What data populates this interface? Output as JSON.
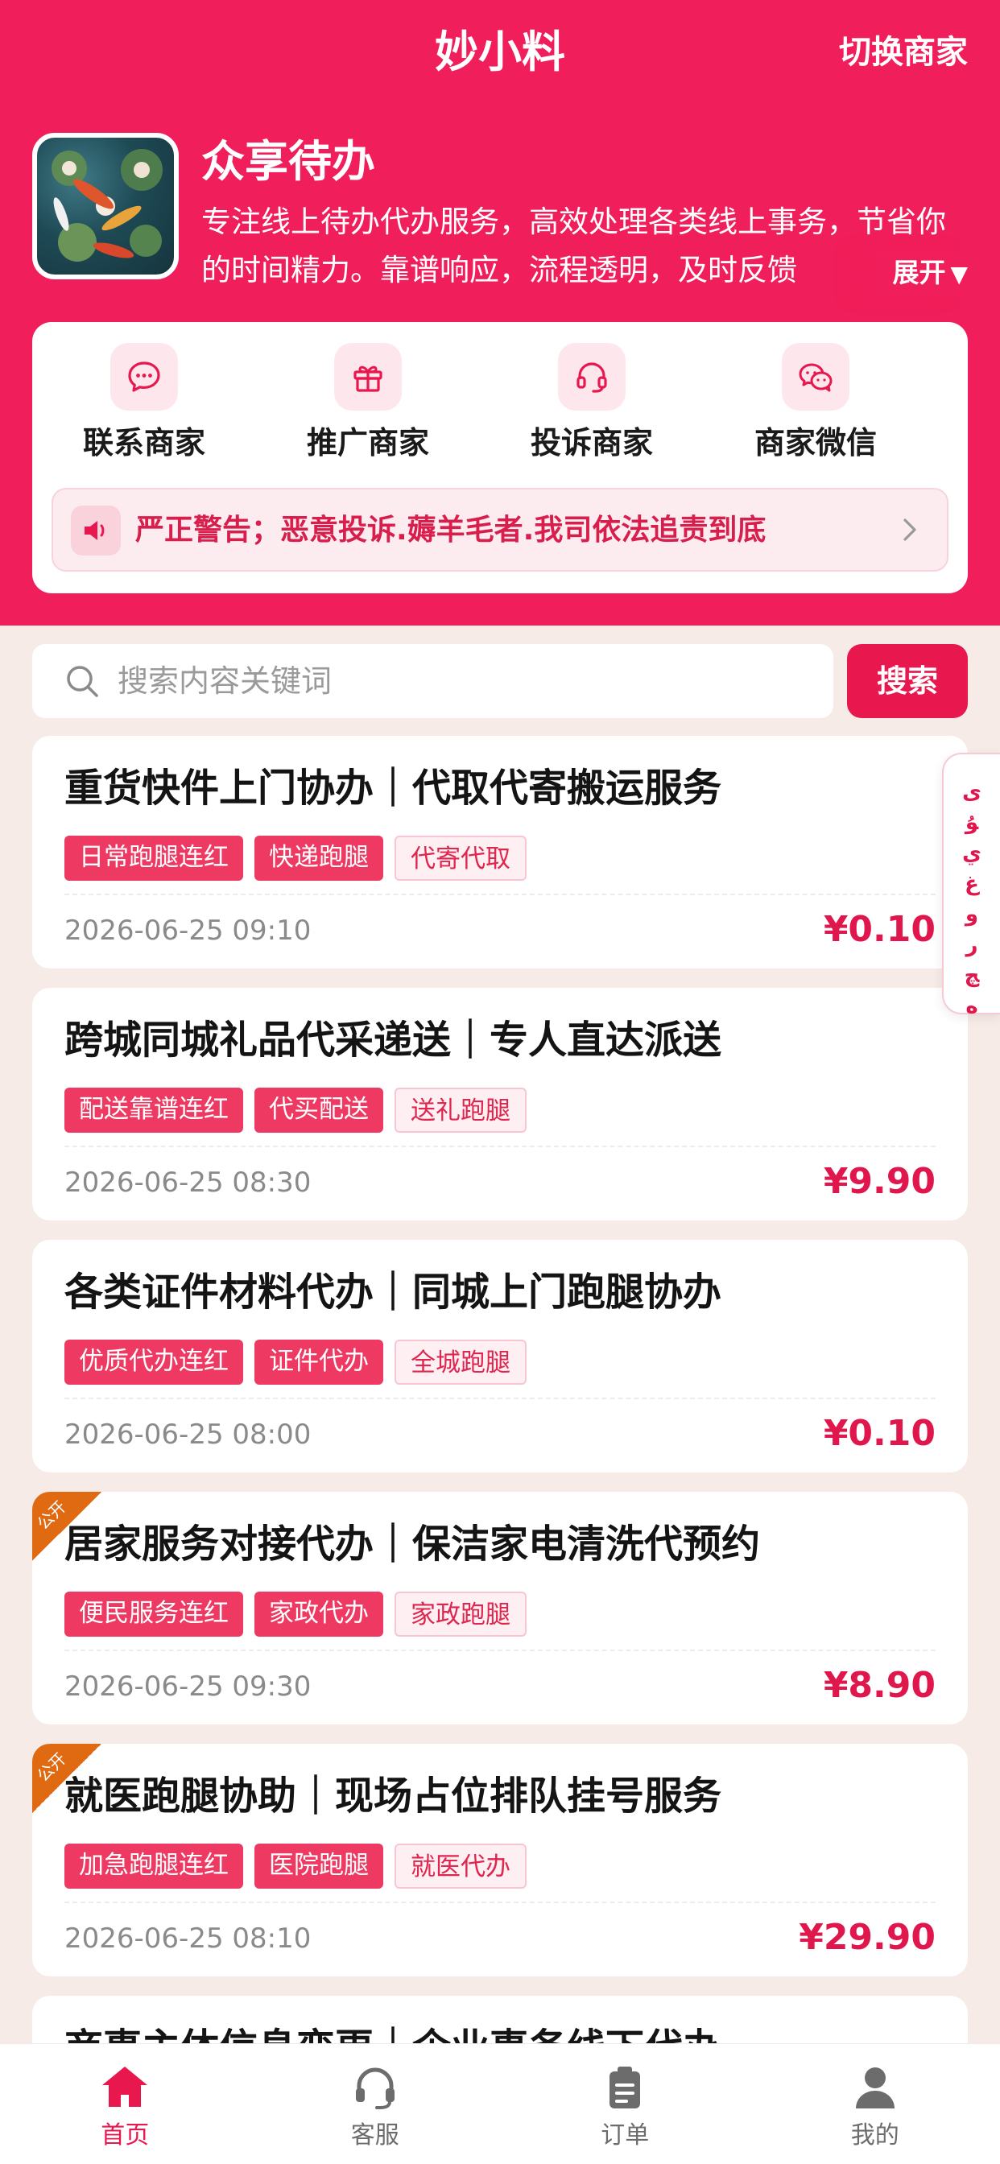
{
  "header": {
    "title": "妙小料",
    "switch_label": "切换商家",
    "shop_name": "众享待办",
    "shop_desc": "专注线上待办代办服务，高效处理各类线上事务，节省你的时间精力。靠谱响应，流程透明，及时反馈",
    "expand_label": "展开"
  },
  "actions": [
    {
      "label": "联系商家",
      "icon": "chat-bubble-icon"
    },
    {
      "label": "推广商家",
      "icon": "gift-icon"
    },
    {
      "label": "投诉商家",
      "icon": "headset-icon"
    },
    {
      "label": "商家微信",
      "icon": "wechat-icon"
    }
  ],
  "notice": {
    "text": "严正警告；恶意投诉.薅羊毛者.我司依法追责到底"
  },
  "search": {
    "placeholder": "搜索内容关键词",
    "button_label": "搜索"
  },
  "side_float": {
    "text": "ﻯ ﯘ ﻱ ﻍ ﻭ ﺭ ﭻ ﻩ"
  },
  "listings": [
    {
      "title": "重货快件上门协办｜代取代寄搬运服务",
      "tags": [
        "日常跑腿连红",
        "快递跑腿",
        "代寄代取"
      ],
      "time": "2026-06-25 09:10",
      "price": "¥0.10",
      "ribbon": ""
    },
    {
      "title": "跨城同城礼品代采递送｜专人直达派送",
      "tags": [
        "配送靠谱连红",
        "代买配送",
        "送礼跑腿"
      ],
      "time": "2026-06-25 08:30",
      "price": "¥9.90",
      "ribbon": ""
    },
    {
      "title": "各类证件材料代办｜同城上门跑腿协办",
      "tags": [
        "优质代办连红",
        "证件代办",
        "全城跑腿"
      ],
      "time": "2026-06-25 08:00",
      "price": "¥0.10",
      "ribbon": ""
    },
    {
      "title": "居家服务对接代办｜保洁家电清洗代预约",
      "tags": [
        "便民服务连红",
        "家政代办",
        "家政跑腿"
      ],
      "time": "2026-06-25 09:30",
      "price": "¥8.90",
      "ribbon": "公开"
    },
    {
      "title": "就医跑腿协助｜现场占位排队挂号服务",
      "tags": [
        "加急跑腿连红",
        "医院跑腿",
        "就医代办"
      ],
      "time": "2026-06-25 08:10",
      "price": "¥29.90",
      "ribbon": "公开"
    },
    {
      "title": "商事主体信息变更｜企业事务线下代办",
      "tags": [],
      "time": "",
      "price": "",
      "ribbon": ""
    }
  ],
  "tabbar": [
    {
      "label": "首页",
      "icon": "home-icon",
      "active": true
    },
    {
      "label": "客服",
      "icon": "headset-icon",
      "active": false
    },
    {
      "label": "订单",
      "icon": "clipboard-icon",
      "active": false
    },
    {
      "label": "我的",
      "icon": "user-icon",
      "active": false
    }
  ],
  "colors": {
    "brand": "#f01e5a",
    "accent": "#e8184f",
    "price": "#e0174d",
    "ribbon": "#e06a12"
  }
}
